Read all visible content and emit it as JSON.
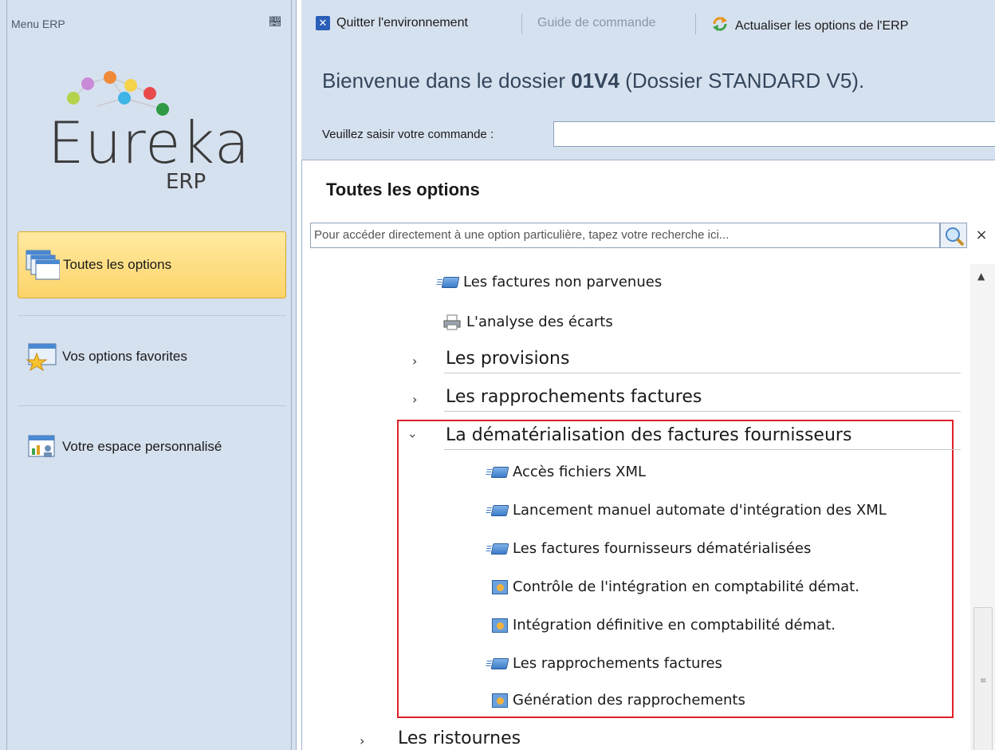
{
  "left_panel": {
    "header": "Menu ERP",
    "logo": {
      "text": "Eureka",
      "sub": "ERP"
    },
    "items": [
      {
        "label": "Toutes les options",
        "active": true
      },
      {
        "label": "Vos options favorites",
        "active": false
      },
      {
        "label": "Votre espace personnalisé",
        "active": false
      }
    ]
  },
  "toolbar": {
    "quit_label": "Quitter l'environnement",
    "guide_label": "Guide de commande",
    "refresh_label": "Actualiser les options de l'ERP"
  },
  "welcome": {
    "prefix": "Bienvenue dans le dossier ",
    "dossier_code": "01V4",
    "suffix": " (Dossier STANDARD V5).",
    "command_label": "Veuillez saisir votre commande :",
    "command_value": ""
  },
  "options": {
    "title": "Toutes les options",
    "search_placeholder": "Pour accéder directement à une option particulière, tapez votre recherche ici...",
    "tree": {
      "item_factures_non_parvenues": "Les factures non parvenues",
      "item_analyse_ecarts": "L'analyse des écarts",
      "cat_provisions": "Les provisions",
      "cat_rapprochements": "Les rapprochements factures",
      "cat_dematerialisation": "La dématérialisation des factures fournisseurs",
      "sub_acces_xml": "Accès fichiers XML",
      "sub_lancement": "Lancement manuel automate d'intégration des XML",
      "sub_factures_demat": "Les factures fournisseurs dématérialisées",
      "sub_controle": "Contrôle de l'intégration en comptabilité démat.",
      "sub_integration": "Intégration définitive en comptabilité démat.",
      "sub_rapprochements": "Les rapprochements factures",
      "sub_generation": "Génération des rapprochements",
      "cat_ristournes": "Les ristournes"
    }
  },
  "colors": {
    "panel": "#d6e1ef",
    "active_item": "#fdd46a",
    "highlight": "#e0202a"
  }
}
